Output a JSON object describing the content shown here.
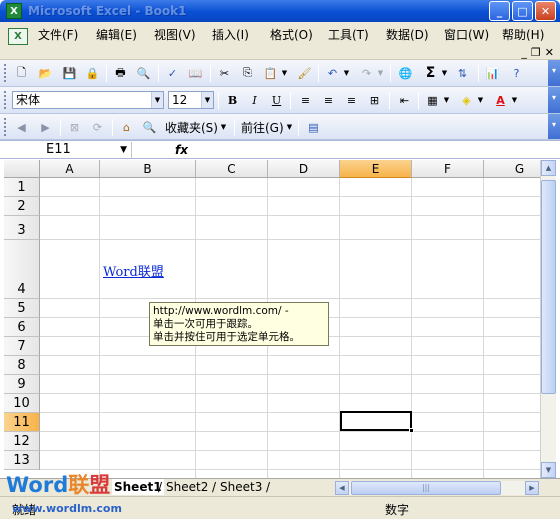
{
  "window": {
    "title": "Microsoft Excel - Book1",
    "buttons": [
      "_",
      "□",
      "✕"
    ]
  },
  "menu": {
    "items": [
      "文件(F)",
      "编辑(E)",
      "视图(V)",
      "插入(I)",
      "格式(O)",
      "工具(T)",
      "数据(D)",
      "窗口(W)",
      "帮助(H)"
    ],
    "doc_controls": [
      "_",
      "❐",
      "✕"
    ]
  },
  "formatting": {
    "font_name": "宋体",
    "font_size": "12"
  },
  "web_toolbar": {
    "favorites": "收藏夹(S)",
    "goto": "前往(G)"
  },
  "formula_bar": {
    "cell_ref": "E11",
    "fx": "fx",
    "content": ""
  },
  "sheet": {
    "columns": [
      "A",
      "B",
      "C",
      "D",
      "E",
      "F",
      "G"
    ],
    "selected_column": "E",
    "rows": [
      "1",
      "2",
      "3",
      "4",
      "5",
      "6",
      "7",
      "8",
      "9",
      "10",
      "11",
      "12",
      "13"
    ],
    "selected_row": "11",
    "hyperlink_text": "Word联盟",
    "tooltip": {
      "line1": "http://www.wordlm.com/ -",
      "line2": "单击一次可用于跟踪。",
      "line3": "单击并按住可用于选定单元格。"
    }
  },
  "tabs": [
    "Sheet1",
    "Sheet2",
    "Sheet3"
  ],
  "status": {
    "ready": "就绪",
    "mode": "数字"
  },
  "watermark": {
    "part1": "Word",
    "part2": "联",
    "part3": "盟",
    "url": "www.wordlm.com"
  }
}
